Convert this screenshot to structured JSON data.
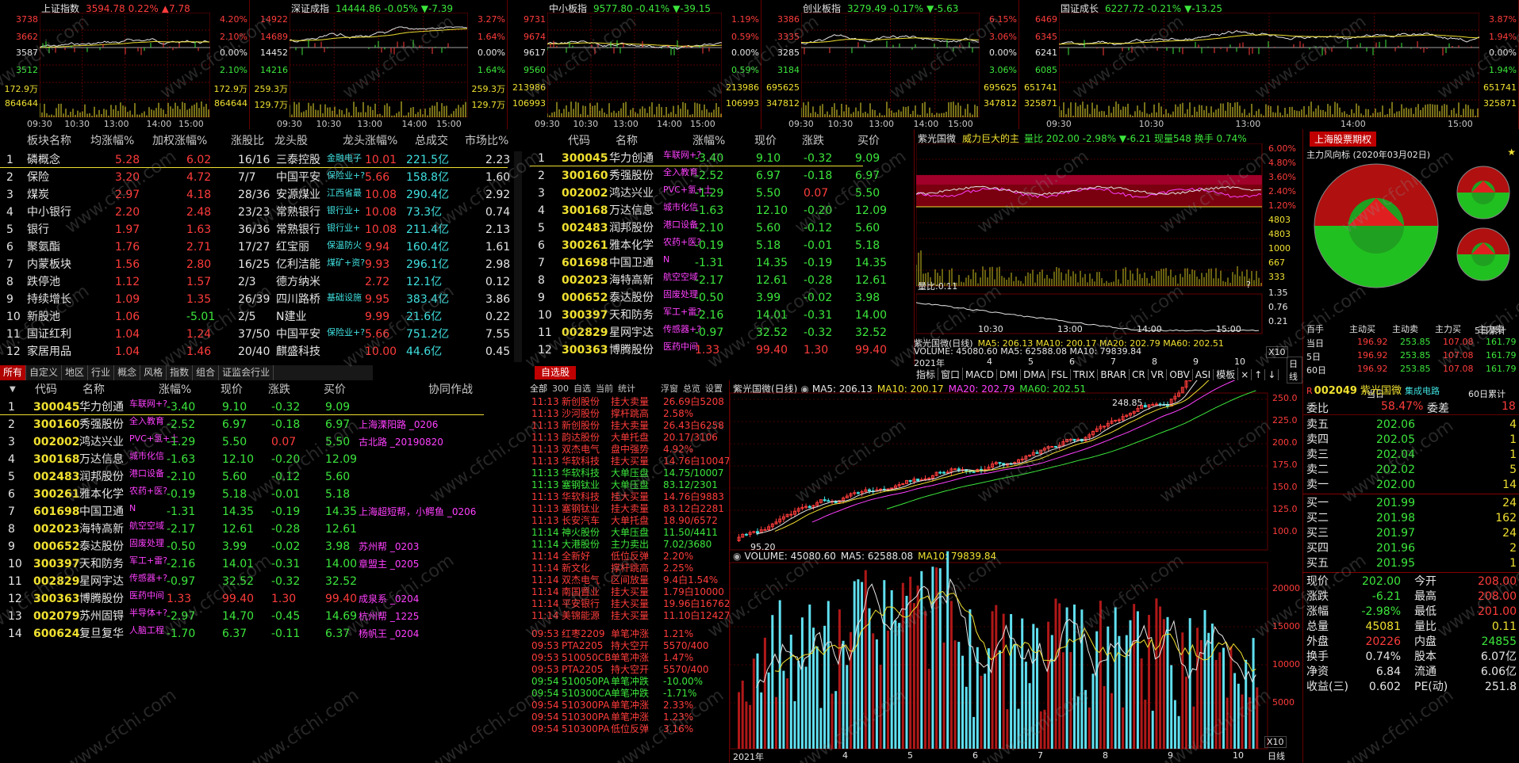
{
  "mini_charts": [
    {
      "name": "上证指数",
      "price": "3594.78",
      "pct": "0.22%",
      "chg": "▲7.78",
      "dir": "up",
      "left_axis": [
        "3738",
        "3662",
        "3587",
        "3512",
        "172.9万",
        "864644"
      ],
      "right_axis": [
        "4.20%",
        "2.10%",
        "0.00%",
        "2.10%",
        "172.9万",
        "864644"
      ],
      "times": [
        "09:30",
        "10:30",
        "13:00",
        "14:00",
        "15:00"
      ]
    },
    {
      "name": "深证成指",
      "price": "14444.86",
      "pct": "-0.05%",
      "chg": "▼-7.39",
      "dir": "down",
      "left_axis": [
        "14922",
        "14689",
        "14452",
        "14216",
        "259.3万",
        "129.7万"
      ],
      "right_axis": [
        "3.27%",
        "1.64%",
        "0.00%",
        "1.64%",
        "259.3万",
        "129.7万"
      ],
      "times": [
        "09:30",
        "10:30",
        "13:00",
        "14:00",
        "15:00"
      ]
    },
    {
      "name": "中小板指",
      "price": "9577.80",
      "pct": "-0.41%",
      "chg": "▼-39.15",
      "dir": "down",
      "left_axis": [
        "9731",
        "9674",
        "9617",
        "9560",
        "213986",
        "106993"
      ],
      "right_axis": [
        "1.19%",
        "0.59%",
        "0.00%",
        "0.59%",
        "213986",
        "106993"
      ],
      "times": [
        "09:30",
        "10:30",
        "13:00",
        "14:00",
        "15:00"
      ]
    },
    {
      "name": "创业板指",
      "price": "3279.49",
      "pct": "-0.17%",
      "chg": "▼-5.63",
      "dir": "down",
      "left_axis": [
        "3386",
        "3335",
        "3285",
        "3184",
        "695625",
        "347812"
      ],
      "right_axis": [
        "6.15%",
        "3.06%",
        "0.00%",
        "3.06%",
        "695625",
        "347812"
      ],
      "times": [
        "09:30",
        "10:30",
        "13:00",
        "14:00",
        "15:00"
      ]
    },
    {
      "name": "国证成长",
      "price": "6227.72",
      "pct": "-0.21%",
      "chg": "▼-13.25",
      "dir": "down",
      "left_axis": [
        "6469",
        "6345",
        "6241",
        "6085",
        "651741",
        "325871"
      ],
      "right_axis": [
        "3.87%",
        "1.94%",
        "0.00%",
        "1.94%",
        "651741",
        "325871"
      ],
      "times": [
        "09:30",
        "10:30",
        "13:00",
        "14:00",
        "15:00"
      ]
    }
  ],
  "sector": {
    "headers": [
      "板块名称",
      "均涨幅%",
      "加权涨幅%",
      "涨股比",
      "龙头股",
      "龙头涨幅%",
      "总成交",
      "市场比%"
    ],
    "rows": [
      [
        "1",
        "磷概念",
        "5.28",
        "6.02",
        "16/16",
        "三泰控股",
        "金融电子",
        "10.01",
        "221.5亿",
        "2.23"
      ],
      [
        "2",
        "保险",
        "3.20",
        "4.72",
        "7/7",
        "中国平安",
        "保险业+?",
        "5.66",
        "158.8亿",
        "1.60"
      ],
      [
        "3",
        "煤炭",
        "2.97",
        "4.18",
        "28/36",
        "安源煤业",
        "江西省最",
        "10.08",
        "290.4亿",
        "2.92"
      ],
      [
        "4",
        "中小银行",
        "2.20",
        "2.48",
        "23/23",
        "常熟银行",
        "银行业+",
        "10.08",
        "73.3亿",
        "0.74"
      ],
      [
        "5",
        "银行",
        "1.97",
        "1.63",
        "36/36",
        "常熟银行",
        "银行业+",
        "10.08",
        "211.4亿",
        "2.13"
      ],
      [
        "6",
        "聚氨酯",
        "1.76",
        "2.71",
        "17/27",
        "红宝丽",
        "保温防火",
        "9.94",
        "160.4亿",
        "1.61"
      ],
      [
        "7",
        "内蒙板块",
        "1.56",
        "2.80",
        "16/25",
        "亿利洁能",
        "煤矿+资?",
        "9.93",
        "296.1亿",
        "2.98"
      ],
      [
        "8",
        "跌停池",
        "1.12",
        "1.57",
        "2/3",
        "德方纳米",
        "",
        "2.72",
        "12.1亿",
        "0.12"
      ],
      [
        "9",
        "持续增长",
        "1.09",
        "1.35",
        "26/39",
        "四川路桥",
        "基础设施",
        "9.95",
        "383.4亿",
        "3.86"
      ],
      [
        "10",
        "新股池",
        "1.06",
        "-5.01",
        "2/5",
        "N建业",
        "",
        "9.99",
        "21.6亿",
        "0.22"
      ],
      [
        "11",
        "国证红利",
        "1.04",
        "1.24",
        "37/50",
        "中国平安",
        "保险业+?",
        "5.66",
        "751.2亿",
        "7.55"
      ],
      [
        "12",
        "家居用品",
        "1.04",
        "1.46",
        "20/40",
        "麒盛科技",
        "",
        "10.00",
        "44.6亿",
        "0.45"
      ]
    ]
  },
  "watch_top": {
    "headers": [
      "代码",
      "名称",
      "涨幅%",
      "现价",
      "涨跌",
      "买价"
    ],
    "rows": [
      [
        "1",
        "300045",
        "华力创通",
        "车联网+?",
        "-3.40",
        "9.10",
        "-0.32",
        "9.09"
      ],
      [
        "2",
        "300160",
        "秀强股份",
        "全入教育",
        "-2.52",
        "6.97",
        "-0.18",
        "6.97"
      ],
      [
        "3",
        "002002",
        "鸿达兴业",
        "PVC+氢+土",
        "-1.29",
        "5.50",
        "0.07",
        "5.50"
      ],
      [
        "4",
        "300168",
        "万达信息",
        "城市化信",
        "-1.63",
        "12.10",
        "-0.20",
        "12.09"
      ],
      [
        "5",
        "002483",
        "润邦股份",
        "港口设备",
        "-2.10",
        "5.60",
        "-0.12",
        "5.60"
      ],
      [
        "6",
        "300261",
        "雅本化学",
        "农药+医?",
        "-0.19",
        "5.18",
        "-0.01",
        "5.18"
      ],
      [
        "7",
        "601698",
        "中国卫通",
        "N",
        "-1.31",
        "14.35",
        "-0.19",
        "14.35"
      ],
      [
        "8",
        "002023",
        "海特高新",
        "航空空域",
        "-2.17",
        "12.61",
        "-0.28",
        "12.61"
      ],
      [
        "9",
        "000652",
        "泰达股份",
        "固废处理",
        "-0.50",
        "3.99",
        "-0.02",
        "3.98"
      ],
      [
        "10",
        "300397",
        "天和防务",
        "军工+雷?",
        "-2.16",
        "14.01",
        "-0.31",
        "14.00"
      ],
      [
        "11",
        "002829",
        "星网宇达",
        "传感器+?",
        "-0.97",
        "32.52",
        "-0.32",
        "32.52"
      ],
      [
        "12",
        "300363",
        "博腾股份",
        "医药中间",
        "1.33",
        "99.40",
        "1.30",
        "99.40"
      ]
    ]
  },
  "tabs_left": [
    "所有",
    "自定义",
    "地区",
    "行业",
    "概念",
    "风格",
    "指数",
    "组合",
    "证监会行业"
  ],
  "watch_main": {
    "headers": [
      "代码",
      "名称",
      "涨幅%",
      "现价",
      "涨跌",
      "买价",
      "协同作战"
    ],
    "rows": [
      [
        "1",
        "300045",
        "华力创通",
        "车联网+?",
        "-3.40",
        "9.10",
        "-0.32",
        "9.09",
        ""
      ],
      [
        "2",
        "300160",
        "秀强股份",
        "全入教育",
        "-2.52",
        "6.97",
        "-0.18",
        "6.97",
        "上海溧阳路 _0206"
      ],
      [
        "3",
        "002002",
        "鸿达兴业",
        "PVC+氢+土",
        "-1.29",
        "5.50",
        "0.07",
        "5.50",
        "古北路 _20190820"
      ],
      [
        "4",
        "300168",
        "万达信息",
        "城市化信",
        "-1.63",
        "12.10",
        "-0.20",
        "12.09",
        ""
      ],
      [
        "5",
        "002483",
        "润邦股份",
        "港口设备",
        "-2.10",
        "5.60",
        "-0.12",
        "5.60",
        ""
      ],
      [
        "6",
        "300261",
        "雅本化学",
        "农药+医?",
        "-0.19",
        "5.18",
        "-0.01",
        "5.18",
        ""
      ],
      [
        "7",
        "601698",
        "中国卫通",
        "N",
        "-1.31",
        "14.35",
        "-0.19",
        "14.35",
        "上海超短帮，小鳄鱼 _0206"
      ],
      [
        "8",
        "002023",
        "海特高新",
        "航空空域",
        "-2.17",
        "12.61",
        "-0.28",
        "12.61",
        ""
      ],
      [
        "9",
        "000652",
        "泰达股份",
        "固废处理",
        "-0.50",
        "3.99",
        "-0.02",
        "3.98",
        "苏州帮 _0203"
      ],
      [
        "10",
        "300397",
        "天和防务",
        "军工+雷?",
        "-2.16",
        "14.01",
        "-0.31",
        "14.00",
        "章盟主 _0205"
      ],
      [
        "11",
        "002829",
        "星网宇达",
        "传感器+?",
        "-0.97",
        "32.52",
        "-0.32",
        "32.52",
        ""
      ],
      [
        "12",
        "300363",
        "博腾股份",
        "医药中间",
        "1.33",
        "99.40",
        "1.30",
        "99.40",
        "成泉系 _0204"
      ],
      [
        "13",
        "002079",
        "苏州固锝",
        "半导体+?",
        "-2.97",
        "14.70",
        "-0.45",
        "14.69",
        "杭州帮 _1225"
      ],
      [
        "14",
        "600624",
        "复旦复华",
        "人脑工程",
        "-1.70",
        "6.37",
        "-0.11",
        "6.37",
        "杨帆王 _0204"
      ]
    ]
  },
  "alert": {
    "title": "自选股",
    "tabs": [
      "全部",
      "300",
      "自选",
      "当前",
      "统计",
      "浮窗",
      "总览",
      "设置"
    ],
    "rows": [
      [
        "11:13",
        "新创股份",
        "挂大卖量",
        "26.69白5208",
        "r"
      ],
      [
        "11:13",
        "沙河股份",
        "撑杆跳高",
        "2.58%",
        "r"
      ],
      [
        "11:13",
        "新创股份",
        "挂大卖量",
        "26.43白6258",
        "r"
      ],
      [
        "11:13",
        "韵达股份",
        "大单托盘",
        "20.17/3106",
        "r"
      ],
      [
        "11:13",
        "双杰电气",
        "盘中强势",
        "4.92%",
        "r"
      ],
      [
        "11:13",
        "华软科技",
        "挂大买量",
        "14.76白10047",
        "r"
      ],
      [
        "11:13",
        "华软科技",
        "大单压盘",
        "14.75/10007",
        "g"
      ],
      [
        "11:13",
        "塞钢钛业",
        "大单压盘",
        "83.12/2301",
        "g"
      ],
      [
        "11:13",
        "华软科技",
        "挂大买量",
        "14.76白9883",
        "r"
      ],
      [
        "11:13",
        "塞钢钛业",
        "挂大卖量",
        "83.12白2281",
        "r"
      ],
      [
        "11:13",
        "长安汽车",
        "大单托盘",
        "18.90/6572",
        "r"
      ],
      [
        "11:14",
        "神火股份",
        "大单压盘",
        "11.50/4411",
        "g"
      ],
      [
        "11:14",
        "大港股份",
        "主力卖出",
        "7.02/3680",
        "g"
      ],
      [
        "11:14",
        "全新好",
        "低位反弹",
        "2.20%",
        "r"
      ],
      [
        "11:14",
        "新文化",
        "撑杆跳高",
        "2.25%",
        "r"
      ],
      [
        "11:14",
        "双杰电气",
        "区间放量",
        "9.4白1.54%",
        "r"
      ],
      [
        "11:14",
        "南国置业",
        "挂大买量",
        "1.79白10000",
        "r"
      ],
      [
        "11:14",
        "平安银行",
        "挂大买量",
        "19.96白16762",
        "r"
      ],
      [
        "11:14",
        "美锦能源",
        "挂大买量",
        "11.10白12427",
        "r"
      ],
      [
        "09:53",
        "红枣2209",
        "单笔冲涨",
        "1.21%",
        "r"
      ],
      [
        "09:53",
        "PTA2205",
        "持大空开",
        "5570/400",
        "r"
      ],
      [
        "09:53",
        "510050CB",
        "单笔冲涨",
        "1.47%",
        "r"
      ],
      [
        "09:53",
        "PTA2205",
        "持大空开",
        "5570/400",
        "r"
      ],
      [
        "09:54",
        "510050PA",
        "单笔冲跌",
        "-10.00%",
        "g"
      ],
      [
        "09:54",
        "510300CA",
        "单笔冲跌",
        "-1.71%",
        "g"
      ],
      [
        "09:54",
        "510300PA",
        "单笔冲涨",
        "2.33%",
        "r"
      ],
      [
        "09:54",
        "510300PA",
        "单笔冲涨",
        "1.23%",
        "r"
      ],
      [
        "09:54",
        "510300PA",
        "低位反弹",
        "3.16%",
        "r"
      ]
    ]
  },
  "mid": {
    "stock_title": "紫光国微",
    "label": "威力巨大的主",
    "quote": "量比 202.00 -2.98% ▼-6.21 现量548 换手 0.74%",
    "axis": [
      "6.00%",
      "4.80%",
      "3.60%",
      "2.40%",
      "1.20%",
      "4803",
      "4803",
      "1000",
      "667",
      "333"
    ],
    "vol_label": "量比:0.11",
    "vol_axis": [
      "1.35",
      "0.76",
      "0.21"
    ],
    "times": [
      "10:30",
      "13:00",
      "14:00",
      "15:00"
    ]
  },
  "options": {
    "title": "上海股票期权",
    "subtitle": "主力风向标 (2020年03月02日)",
    "labels": [
      "当日",
      "5日累计",
      "60日累计"
    ],
    "headers": [
      "百手",
      "主动买",
      "主动卖",
      "主力买",
      "主力卖"
    ],
    "rows": [
      [
        "当日",
        "196.92",
        "253.85",
        "107.08",
        "161.79"
      ],
      [
        "5日",
        "196.92",
        "253.85",
        "107.08",
        "161.79"
      ],
      [
        "60日",
        "196.92",
        "253.85",
        "107.08",
        "161.79"
      ]
    ]
  },
  "kline_top": {
    "title": "紫光国微(日线)",
    "ma": "MA5: 206.13 MA10: 200.17 MA20: 202.79 MA60: 202.51",
    "vol": "VOLUME: 45080.60 MA5: 62588.08 MA10: 79839.84",
    "months": [
      "2021年",
      "4",
      "5",
      "6",
      "7",
      "8",
      "9",
      "10"
    ],
    "btn": [
      "X10",
      "日线"
    ]
  },
  "indicator_tabs": [
    "指标",
    "窗口",
    "MACD",
    "DMI",
    "DMA",
    "FSL",
    "TRIX",
    "BRAR",
    "CR",
    "VR",
    "OBV",
    "ASI",
    "模板",
    "×",
    "↑",
    "↓"
  ],
  "kline": {
    "title": "紫光国微(日线)",
    "ma5": "MA5: 206.13",
    "ma10": "MA10: 200.17",
    "ma20": "MA20: 202.79",
    "ma60": "MA60: 202.51",
    "price_axis": [
      "250.0",
      "225.0",
      "200.0",
      "175.0",
      "150.0",
      "125.0",
      "100.0"
    ],
    "high": "248.85",
    "low": "95.20",
    "vol_title": "VOLUME: 45080.60",
    "vol_ma5": "MA5: 62588.08",
    "vol_ma10": "MA10: 79839.84",
    "vol_axis": [
      "20000",
      "15000",
      "10000",
      "5000"
    ],
    "months": [
      "2021年",
      "4",
      "5",
      "6",
      "7",
      "8",
      "9",
      "10"
    ],
    "btn": [
      "X10",
      "日线"
    ]
  },
  "book": {
    "code": "002049",
    "name": "紫光国微",
    "concept": "集成电路",
    "wb_label": "委比",
    "wb": "58.47%",
    "wc_label": "委差",
    "wc": "18",
    "sells": [
      [
        "卖五",
        "202.06",
        "4"
      ],
      [
        "卖四",
        "202.05",
        "1"
      ],
      [
        "卖三",
        "202.04",
        "1"
      ],
      [
        "卖二",
        "202.02",
        "5"
      ],
      [
        "卖一",
        "202.00",
        "14"
      ]
    ],
    "buys": [
      [
        "买一",
        "201.99",
        "24"
      ],
      [
        "买二",
        "201.98",
        "162"
      ],
      [
        "买三",
        "201.97",
        "24"
      ],
      [
        "买四",
        "201.96",
        "2"
      ],
      [
        "买五",
        "201.95",
        "1"
      ]
    ],
    "stats": [
      [
        "现价",
        "202.00",
        "今开",
        "208.00"
      ],
      [
        "涨跌",
        "-6.21",
        "最高",
        "208.00"
      ],
      [
        "涨幅",
        "-2.98%",
        "最低",
        "201.00"
      ],
      [
        "总量",
        "45081",
        "量比",
        "0.11"
      ],
      [
        "外盘",
        "20226",
        "内盘",
        "24855"
      ],
      [
        "换手",
        "0.74%",
        "股本",
        "6.07亿"
      ],
      [
        "净资",
        "6.84",
        "流通",
        "6.06亿"
      ],
      [
        "收益(三)",
        "0.602",
        "PE(动)",
        "251.8"
      ]
    ]
  },
  "watermark": "www.cfchi.com"
}
